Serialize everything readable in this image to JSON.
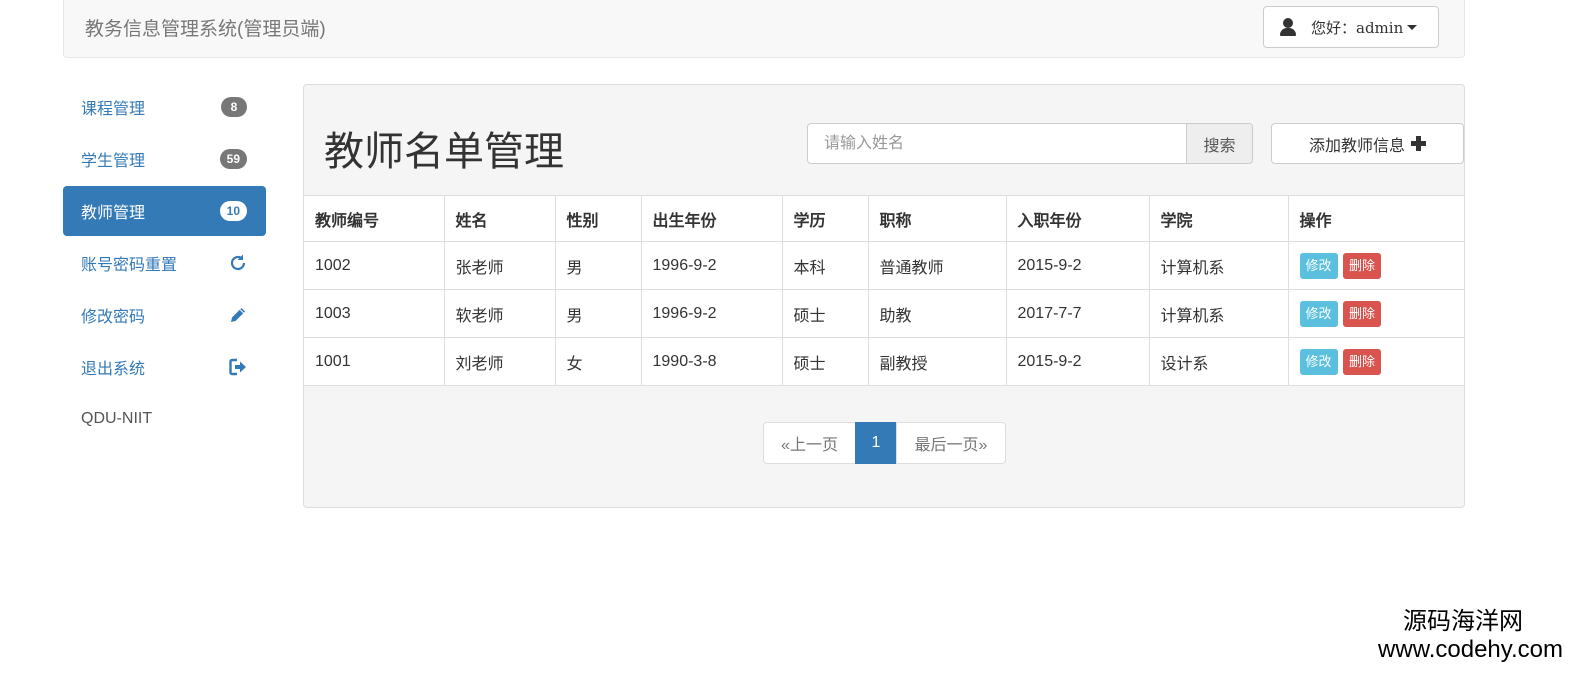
{
  "header": {
    "title": "教务信息管理系统(管理员端)",
    "user_label": "您好：admin"
  },
  "sidebar": {
    "items": [
      {
        "label": "课程管理",
        "badge": "8"
      },
      {
        "label": "学生管理",
        "badge": "59"
      },
      {
        "label": "教师管理",
        "badge": "10",
        "active": true
      },
      {
        "label": "账号密码重置",
        "icon": "refresh-icon"
      },
      {
        "label": "修改密码",
        "icon": "pencil-icon"
      },
      {
        "label": "退出系统",
        "icon": "logout-icon"
      }
    ],
    "footer": "QDU-NIIT"
  },
  "main": {
    "title": "教师名单管理",
    "search_placeholder": "请输入姓名",
    "search_button": "搜索",
    "add_button": "添加教师信息",
    "table": {
      "headers": [
        "教师编号",
        "姓名",
        "性别",
        "出生年份",
        "学历",
        "职称",
        "入职年份",
        "学院",
        "操作"
      ],
      "rows": [
        [
          "1002",
          "张老师",
          "男",
          "1996-9-2",
          "本科",
          "普通教师",
          "2015-9-2",
          "计算机系"
        ],
        [
          "1003",
          "软老师",
          "男",
          "1996-9-2",
          "硕士",
          "助教",
          "2017-7-7",
          "计算机系"
        ],
        [
          "1001",
          "刘老师",
          "女",
          "1990-3-8",
          "硕士",
          "副教授",
          "2015-9-2",
          "设计系"
        ]
      ],
      "edit_label": "修改",
      "delete_label": "删除"
    },
    "pagination": {
      "prev": "«上一页",
      "current": "1",
      "last": "最后一页»"
    }
  },
  "watermark": {
    "line1": "源码海洋网",
    "line2": "www.codehy.com"
  },
  "colors": {
    "primary": "#337ab7",
    "info": "#5bc0de",
    "danger": "#d9534f",
    "badge": "#777777"
  }
}
